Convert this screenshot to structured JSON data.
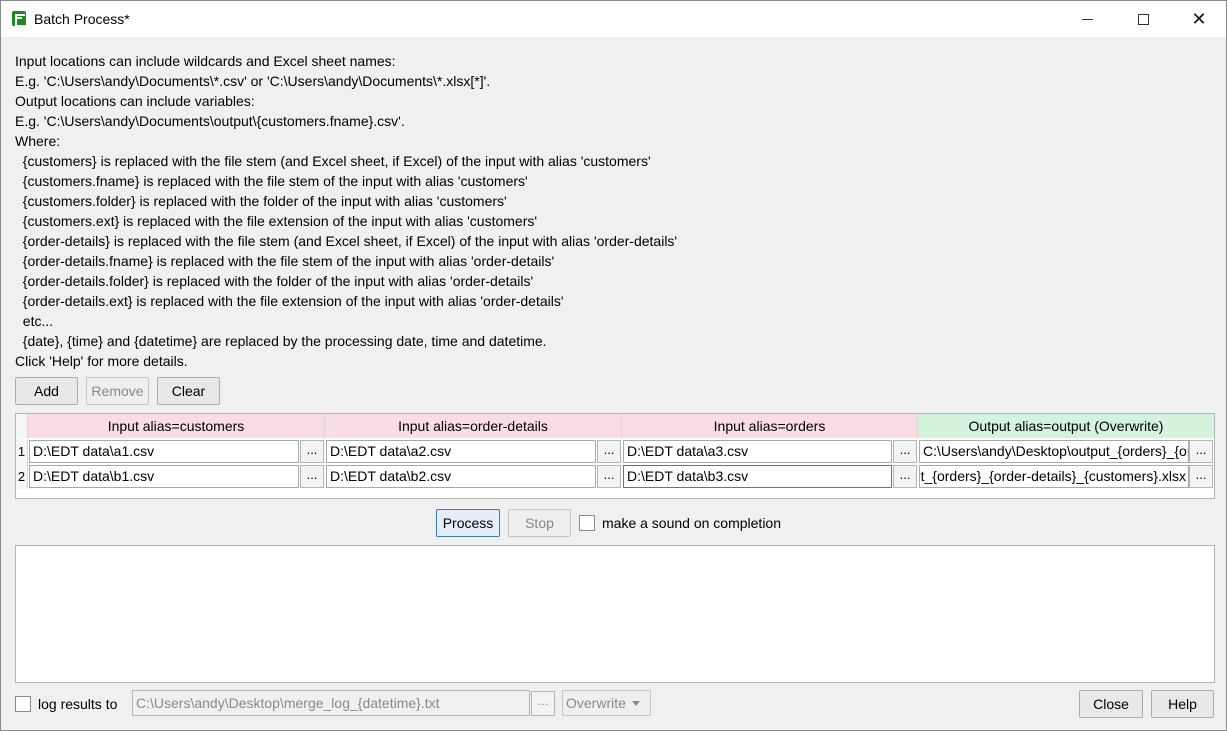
{
  "window": {
    "title": "Batch Process*"
  },
  "info_lines": [
    "Input locations can include wildcards and Excel sheet names:",
    "E.g. 'C:\\Users\\andy\\Documents\\*.csv' or 'C:\\Users\\andy\\Documents\\*.xlsx[*]'.",
    "Output locations can include variables:",
    "E.g. 'C:\\Users\\andy\\Documents\\output\\{customers.fname}.csv'.",
    "Where:",
    "  {customers} is replaced with the file stem (and Excel sheet, if Excel) of the input with alias 'customers'",
    "  {customers.fname} is replaced with the file stem of the input with alias 'customers'",
    "  {customers.folder} is replaced with the folder of the input with alias 'customers'",
    "  {customers.ext} is replaced with the file extension of the input with alias 'customers'",
    "  {order-details} is replaced with the file stem (and Excel sheet, if Excel) of the input with alias 'order-details'",
    "  {order-details.fname} is replaced with the file stem of the input with alias 'order-details'",
    "  {order-details.folder} is replaced with the folder of the input with alias 'order-details'",
    "  {order-details.ext} is replaced with the file extension of the input with alias 'order-details'",
    "  etc...",
    "  {date}, {time} and {datetime} are replaced by the processing date, time and datetime.",
    "Click 'Help' for more details."
  ],
  "toolbar": {
    "add": "Add",
    "remove": "Remove",
    "clear": "Clear"
  },
  "table": {
    "headers": [
      "Input alias=customers",
      "Input alias=order-details",
      "Input alias=orders",
      "Output alias=output (Overwrite)"
    ],
    "browse_label": "...",
    "rows": [
      {
        "num": "1",
        "cells": [
          "D:\\EDT data\\a1.csv",
          "D:\\EDT data\\a2.csv",
          "D:\\EDT data\\a3.csv",
          "C:\\Users\\andy\\Desktop\\output_{orders}_{order-details}_{customers}.xlsx"
        ]
      },
      {
        "num": "2",
        "cells": [
          "D:\\EDT data\\b1.csv",
          "D:\\EDT data\\b2.csv",
          "D:\\EDT data\\b3.csv",
          "C:\\Users\\andy\\Desktop\\output_{orders}_{order-details}_{customers}.xlsx"
        ]
      }
    ]
  },
  "process": {
    "process": "Process",
    "stop": "Stop",
    "sound_label": "make a sound on completion"
  },
  "footer": {
    "log_label": "log results to",
    "log_path": "C:\\Users\\andy\\Desktop\\merge_log_{datetime}.txt",
    "browse_label": "...",
    "mode": "Overwrite",
    "close": "Close",
    "help": "Help"
  }
}
